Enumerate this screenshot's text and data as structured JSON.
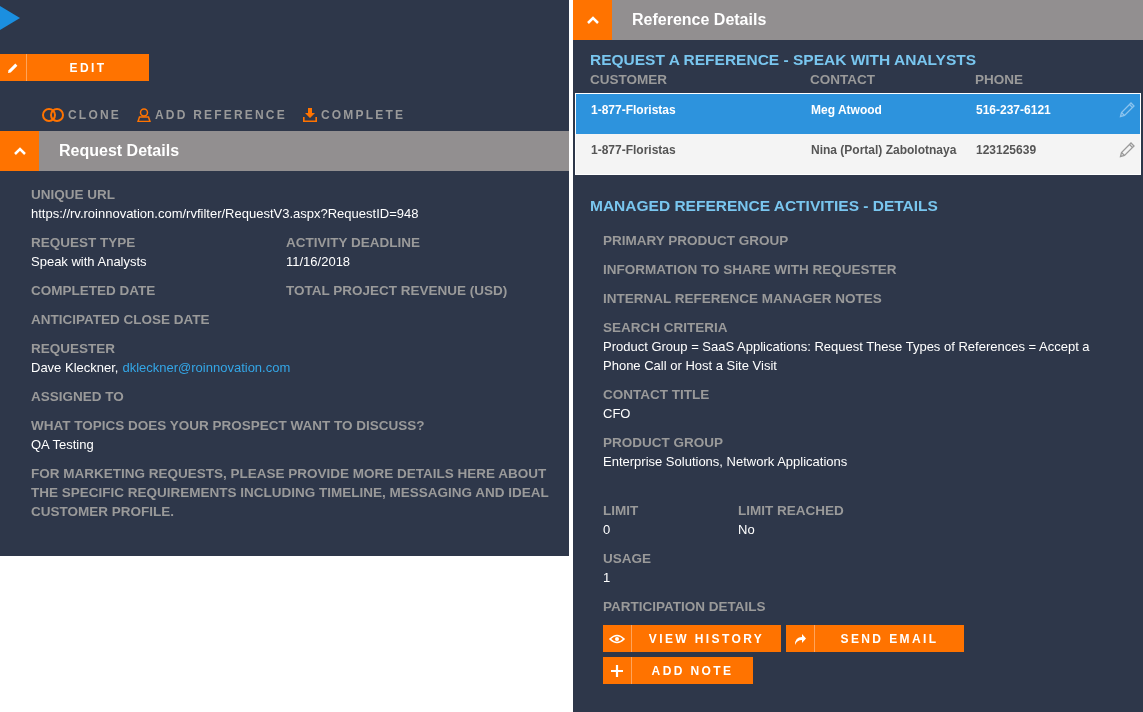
{
  "toolbar": {
    "edit_button": {
      "label": "EDIT",
      "kind": "edit"
    },
    "actions": [
      {
        "label": "CLONE",
        "kind": "clone"
      },
      {
        "label": "ADD REFERENCE",
        "kind": "person"
      },
      {
        "label": "COMPLETE",
        "kind": "download"
      }
    ]
  },
  "request_details": {
    "title": "Request Details",
    "expanded": true,
    "rows": [
      [
        {
          "label": "UNIQUE URL",
          "value": "https://rv.roinnovation.com/rvfilter/RequestV3.aspx?RequestID=948"
        }
      ],
      [
        {
          "label": "REQUEST TYPE",
          "value": "Speak with Analysts"
        },
        {
          "label": "ACTIVITY DEADLINE",
          "value": "11/16/2018"
        }
      ],
      [
        {
          "label": "COMPLETED DATE"
        },
        {
          "label": "TOTAL PROJECT REVENUE (USD)"
        }
      ],
      [
        {
          "label": "ANTICIPATED CLOSE DATE"
        }
      ],
      [
        {
          "label": "REQUESTER",
          "value": "Dave Kleckner,",
          "link": "dkleckner@roinnovation.com"
        }
      ],
      [
        {
          "label": "ASSIGNED TO"
        }
      ],
      [
        {
          "label": "WHAT TOPICS DOES YOUR PROSPECT WANT TO DISCUSS?",
          "value": "QA Testing"
        }
      ],
      [
        {
          "label": "FOR MARKETING REQUESTS, PLEASE PROVIDE MORE DETAILS HERE ABOUT THE SPECIFIC REQUIREMENTS INCLUDING TIMELINE, MESSAGING AND IDEAL CUSTOMER PROFILE."
        }
      ]
    ]
  },
  "reference_details": {
    "title": "Reference Details",
    "expanded": true,
    "request_title": "REQUEST A REFERENCE - SPEAK WITH ANALYSTS",
    "table": {
      "columns": [
        "CUSTOMER",
        "CONTACT",
        "PHONE"
      ],
      "rows": [
        {
          "cells": [
            "1-877-Floristas",
            "Meg Atwood",
            "516-237-6121"
          ],
          "selected": true
        },
        {
          "cells": [
            "1-877-Floristas",
            "Nina (Portal) Zabolotnaya",
            "123125639"
          ],
          "selected": false
        }
      ]
    },
    "managed_title": "MANAGED REFERENCE ACTIVITIES - DETAILS",
    "rows": [
      [
        {
          "label": "PRIMARY PRODUCT GROUP"
        }
      ],
      [
        {
          "label": "INFORMATION TO SHARE WITH REQUESTER"
        }
      ],
      [
        {
          "label": "INTERNAL REFERENCE MANAGER NOTES"
        }
      ],
      [
        {
          "label": "SEARCH CRITERIA",
          "value": "Product Group = SaaS Applications: Request These Types of References = Accept a Phone Call or Host a Site Visit"
        }
      ],
      [
        {
          "label": "CONTACT TITLE",
          "value": "CFO"
        }
      ],
      [
        {
          "label": "PRODUCT GROUP",
          "value": "Enterprise Solutions, Network Applications"
        }
      ]
    ],
    "limit_rows": [
      [
        {
          "label": "LIMIT",
          "value": "0"
        },
        {
          "label": "LIMIT REACHED",
          "value": "No"
        }
      ],
      [
        {
          "label": "USAGE",
          "value": "1"
        }
      ],
      [
        {
          "label": "PARTICIPATION DETAILS"
        }
      ]
    ],
    "buttons": [
      {
        "label": "VIEW HISTORY",
        "kind": "eye"
      },
      {
        "label": "SEND EMAIL",
        "kind": "share"
      },
      {
        "label": "ADD NOTE",
        "kind": "plus"
      }
    ]
  }
}
